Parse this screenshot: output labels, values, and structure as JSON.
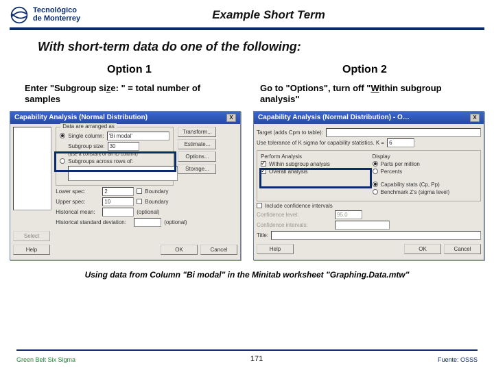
{
  "header": {
    "logo_line1": "Tecnológico",
    "logo_line2": "de Monterrey",
    "title": "Example Short Term"
  },
  "lead": "With short-term data do one of the following:",
  "option1": {
    "heading": "Option 1",
    "desc_pre": "Enter \"Subgroup si",
    "desc_ul": "z",
    "desc_post": "e: \" = total number of samples"
  },
  "option2": {
    "heading": "Option 2",
    "desc_pre": "Go to \"Options\", turn off \"",
    "desc_ul": "W",
    "desc_post": "ithin subgroup analysis\""
  },
  "dialog1": {
    "title": "Capability Analysis (Normal Distribution)",
    "close": "X",
    "group_label": "Data are arranged as",
    "radio_single": "Single column:",
    "val_single": "'Bi modal'",
    "label_subgroup": "Subgroup size:",
    "val_subgroup": "30",
    "hint": "(use a constant or an ID column)",
    "radio_subacross": "Subgroups across rows of:",
    "lower_spec": "Lower spec:",
    "lower_val": "2",
    "boundary1": "Boundary",
    "upper_spec": "Upper spec:",
    "upper_val": "10",
    "boundary2": "Boundary",
    "hist_mean": "Historical mean:",
    "opt1": "(optional)",
    "hist_sd": "Historical standard deviation:",
    "opt2": "(optional)",
    "btn_transform": "Transform...",
    "btn_estimate": "Estimate...",
    "btn_options": "Options...",
    "btn_storage": "Storage...",
    "btn_select": "Select",
    "btn_help": "Help",
    "btn_ok": "OK",
    "btn_cancel": "Cancel"
  },
  "dialog2": {
    "title": "Capability Analysis (Normal Distribution) - O…",
    "close": "X",
    "target_label": "Target (adds Cpm to table):",
    "ksigma_label": "Use tolerance of K sigma for capability statistics.  K =",
    "k_val": "6",
    "perform_title": "Perform Analysis",
    "chk_within": "Within subgroup analysis",
    "chk_overall": "Overall analysis",
    "display_title": "Display",
    "radio_ppm": "Parts per million",
    "radio_pct": "Percents",
    "radio_cap": "Capability stats (Cp, Pp)",
    "radio_bench": "Benchmark Z's (sigma level)",
    "chk_ci": "Include confidence intervals",
    "conf_label": "Confidence level:",
    "conf_val": "95.0",
    "ci_label": "Confidence intervals:",
    "title_lbl": "Title:",
    "btn_help": "Help",
    "btn_ok": "OK",
    "btn_cancel": "Cancel"
  },
  "caption": "Using data from Column \"Bi modal\" in the Minitab worksheet \"Graphing.Data.mtw\"",
  "footer": {
    "left": "Green Belt Six Sigma",
    "page": "171",
    "right": "Fuente: OSSS"
  }
}
